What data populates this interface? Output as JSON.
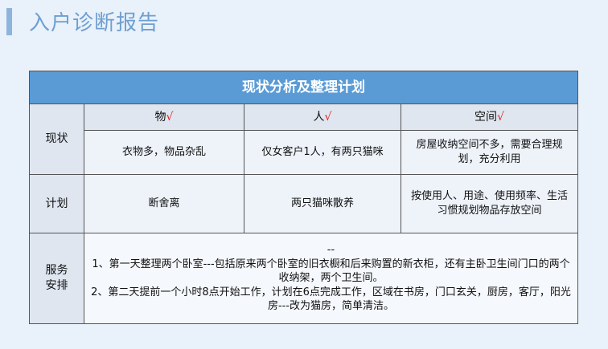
{
  "page": {
    "title": "入户诊断报告"
  },
  "table": {
    "header": "现状分析及整理计划",
    "row_labels": {
      "status": "现状",
      "plan": "计划",
      "service": "服务安排"
    },
    "service_label_lines": [
      "服务",
      "安排"
    ],
    "columns": [
      {
        "label": "物",
        "check": "√"
      },
      {
        "label": "人",
        "check": "√"
      },
      {
        "label": "空间",
        "check": "√"
      }
    ],
    "status": [
      "衣物多，物品杂乱",
      "仅女客户1人，有两只猫咪",
      "房屋收纳空间不多，需要合理规划，充分利用"
    ],
    "plan": [
      "断舍离",
      "两只猫咪散养",
      "按使用人、用途、使用频率、生活习惯规划物品存放空间"
    ],
    "service_lines": [
      "--",
      "1、第一天整理两个卧室---包括原来两个卧室的旧衣橱和后来购置的新衣柜，还有主卧卫生间门口的两个收纳架，两个卫生间。",
      "2、第二天提前一个小时8点开始工作，计划在6点完成工作，区域在书房，门口玄关，厨房，客厅，阳光房---改为猫房，简单清洁。"
    ]
  }
}
